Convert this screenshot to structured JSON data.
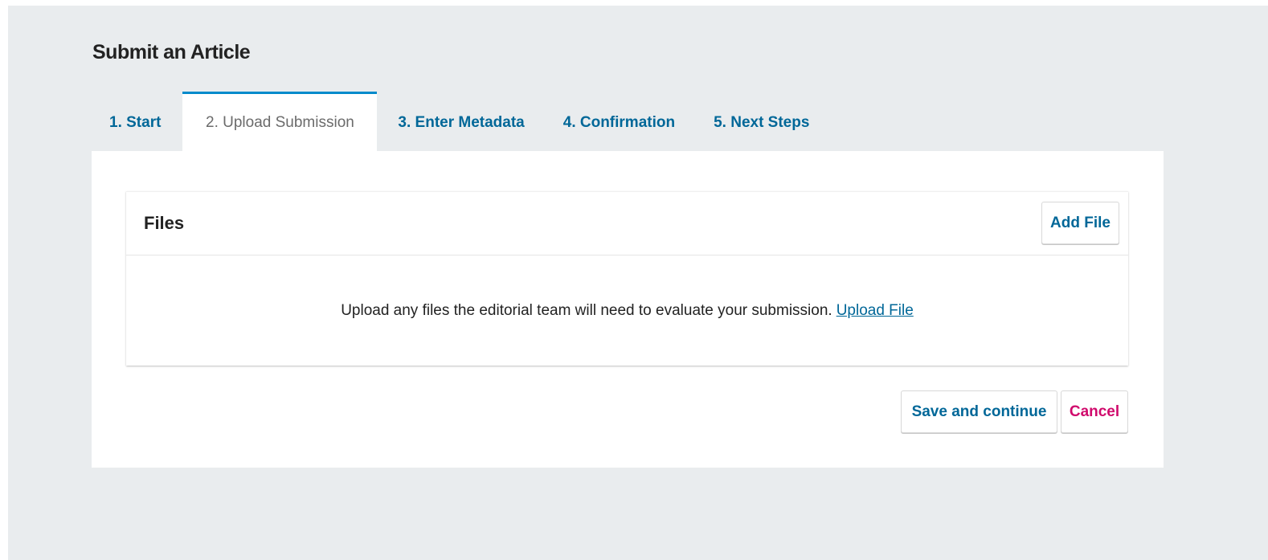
{
  "page": {
    "title": "Submit an Article"
  },
  "tabs": [
    {
      "label": "1. Start",
      "active": false
    },
    {
      "label": "2. Upload Submission",
      "active": true
    },
    {
      "label": "3. Enter Metadata",
      "active": false
    },
    {
      "label": "4. Confirmation",
      "active": false
    },
    {
      "label": "5. Next Steps",
      "active": false
    }
  ],
  "files": {
    "title": "Files",
    "add_label": "Add File",
    "message": "Upload any files the editorial team will need to evaluate your submission.",
    "upload_link": "Upload File"
  },
  "actions": {
    "save_label": "Save and continue",
    "cancel_label": "Cancel"
  },
  "colors": {
    "background": "#e9ecee",
    "link": "#006798",
    "active_tab_border": "#008acb",
    "cancel": "#d00a6c"
  }
}
